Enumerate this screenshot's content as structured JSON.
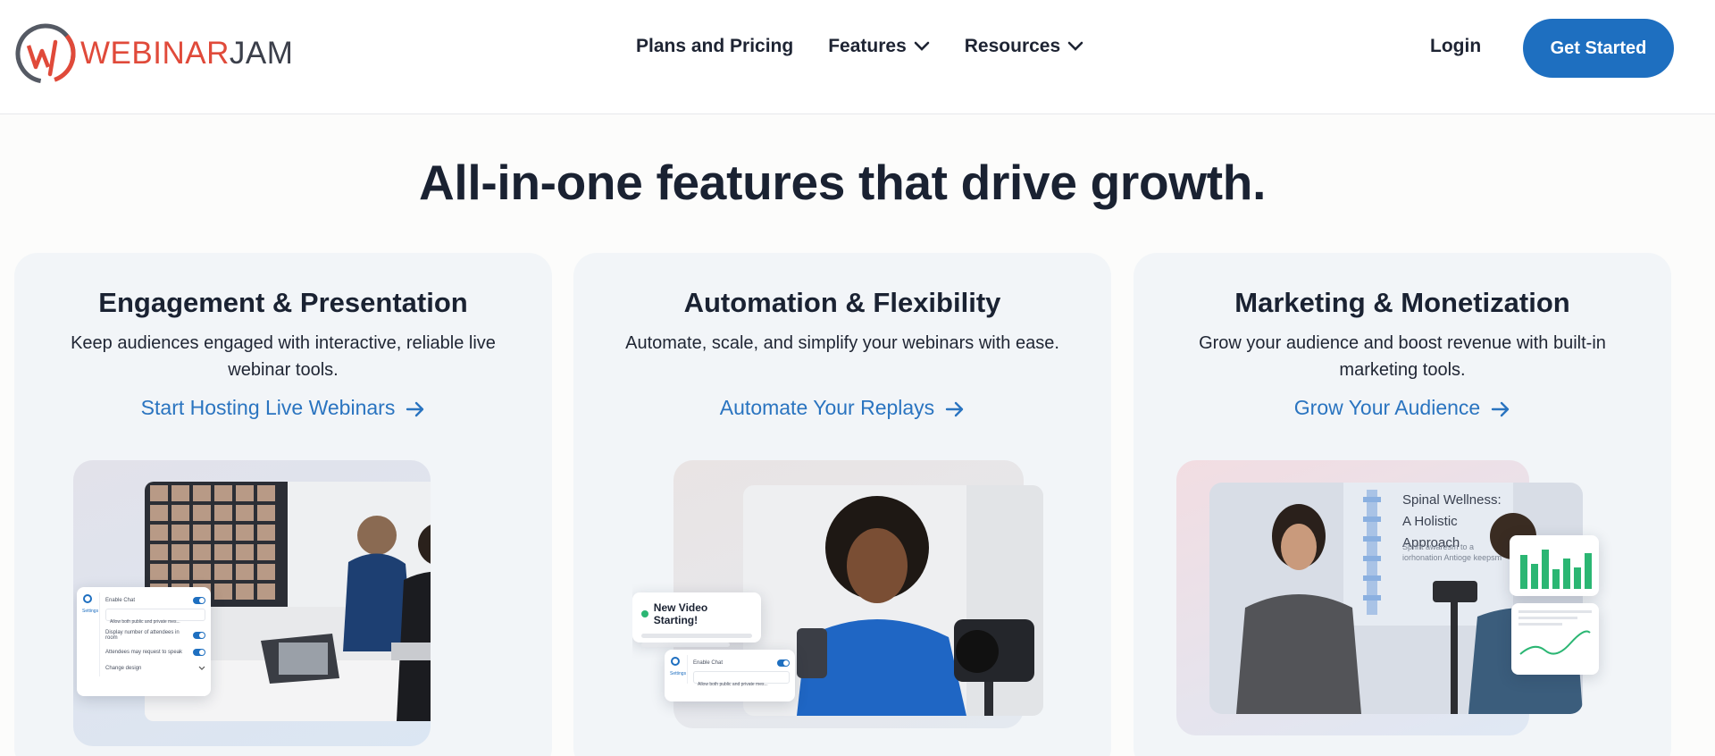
{
  "header": {
    "logo": {
      "brand_primary": "WEBINAR",
      "brand_secondary": "JAM",
      "accent_color": "#e04a3a"
    },
    "nav": [
      {
        "label": "Plans and Pricing",
        "has_dropdown": false
      },
      {
        "label": "Features",
        "has_dropdown": true
      },
      {
        "label": "Resources",
        "has_dropdown": true
      }
    ],
    "login_label": "Login",
    "cta_label": "Get Started",
    "cta_color": "#1e6fc0"
  },
  "headline": "All-in-one features that drive growth.",
  "cards": [
    {
      "title": "Engagement & Presentation",
      "description": "Keep audiences engaged with interactive, reliable live webinar tools.",
      "link_label": "Start Hosting Live Webinars",
      "panel": {
        "settings_label": "Settings",
        "rows": [
          "Enable Chat",
          "Allow both public and private mes...",
          "Display number of attendees in room",
          "Attendees may request to speak",
          "Change design"
        ]
      }
    },
    {
      "title": "Automation & Flexibility",
      "description": "Automate, scale, and simplify your webinars with ease.",
      "link_label": "Automate Your Replays",
      "notification": "New Video Starting!",
      "panel": {
        "settings_label": "Settings",
        "rows": [
          "Enable Chat",
          "Allow both public and private mes..."
        ]
      }
    },
    {
      "title": "Marketing & Monetization",
      "description": "Grow your audience and boost revenue with  built-in marketing tools.",
      "link_label": "Grow Your Audience",
      "slide": {
        "title_line1": "Spinal Wellness:",
        "title_line2": "A Holistic Approach",
        "subtitle": "Sprint awaresm to a iorhonation Antioge keepsm"
      }
    }
  ],
  "link_color": "#2a74c0"
}
